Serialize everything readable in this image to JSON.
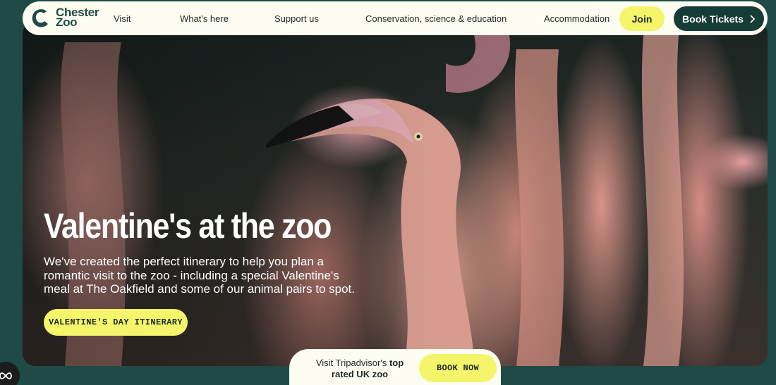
{
  "nav": {
    "logo_line1": "Chester",
    "logo_line2": "Zoo",
    "links": [
      "Visit",
      "What's here",
      "Support us",
      "Conservation, science & education",
      "Accommodation"
    ],
    "join_label": "Join",
    "book_label": "Book Tickets"
  },
  "hero": {
    "title": "Valentine's at the zoo",
    "description": "We've created the perfect itinerary to help you plan a romantic visit to the zoo - including a special Valentine's meal at The Oakfield and some of our animal pairs to spot.",
    "cta_label": "VALENTINE'S DAY ITINERARY"
  },
  "promo": {
    "text_prefix": "Visit Tripadvisor's ",
    "text_bold": "top rated UK zoo",
    "button_label": "BOOK NOW"
  },
  "colors": {
    "brand_dark": "#1f4a46",
    "accent_yellow": "#f5f56b",
    "nav_bg": "#fdfcf0"
  },
  "icons": {
    "logo": "chester-zoo-logo-icon",
    "book_chevron": "chevron-right-icon",
    "corner_widget": "infinity-icon"
  }
}
